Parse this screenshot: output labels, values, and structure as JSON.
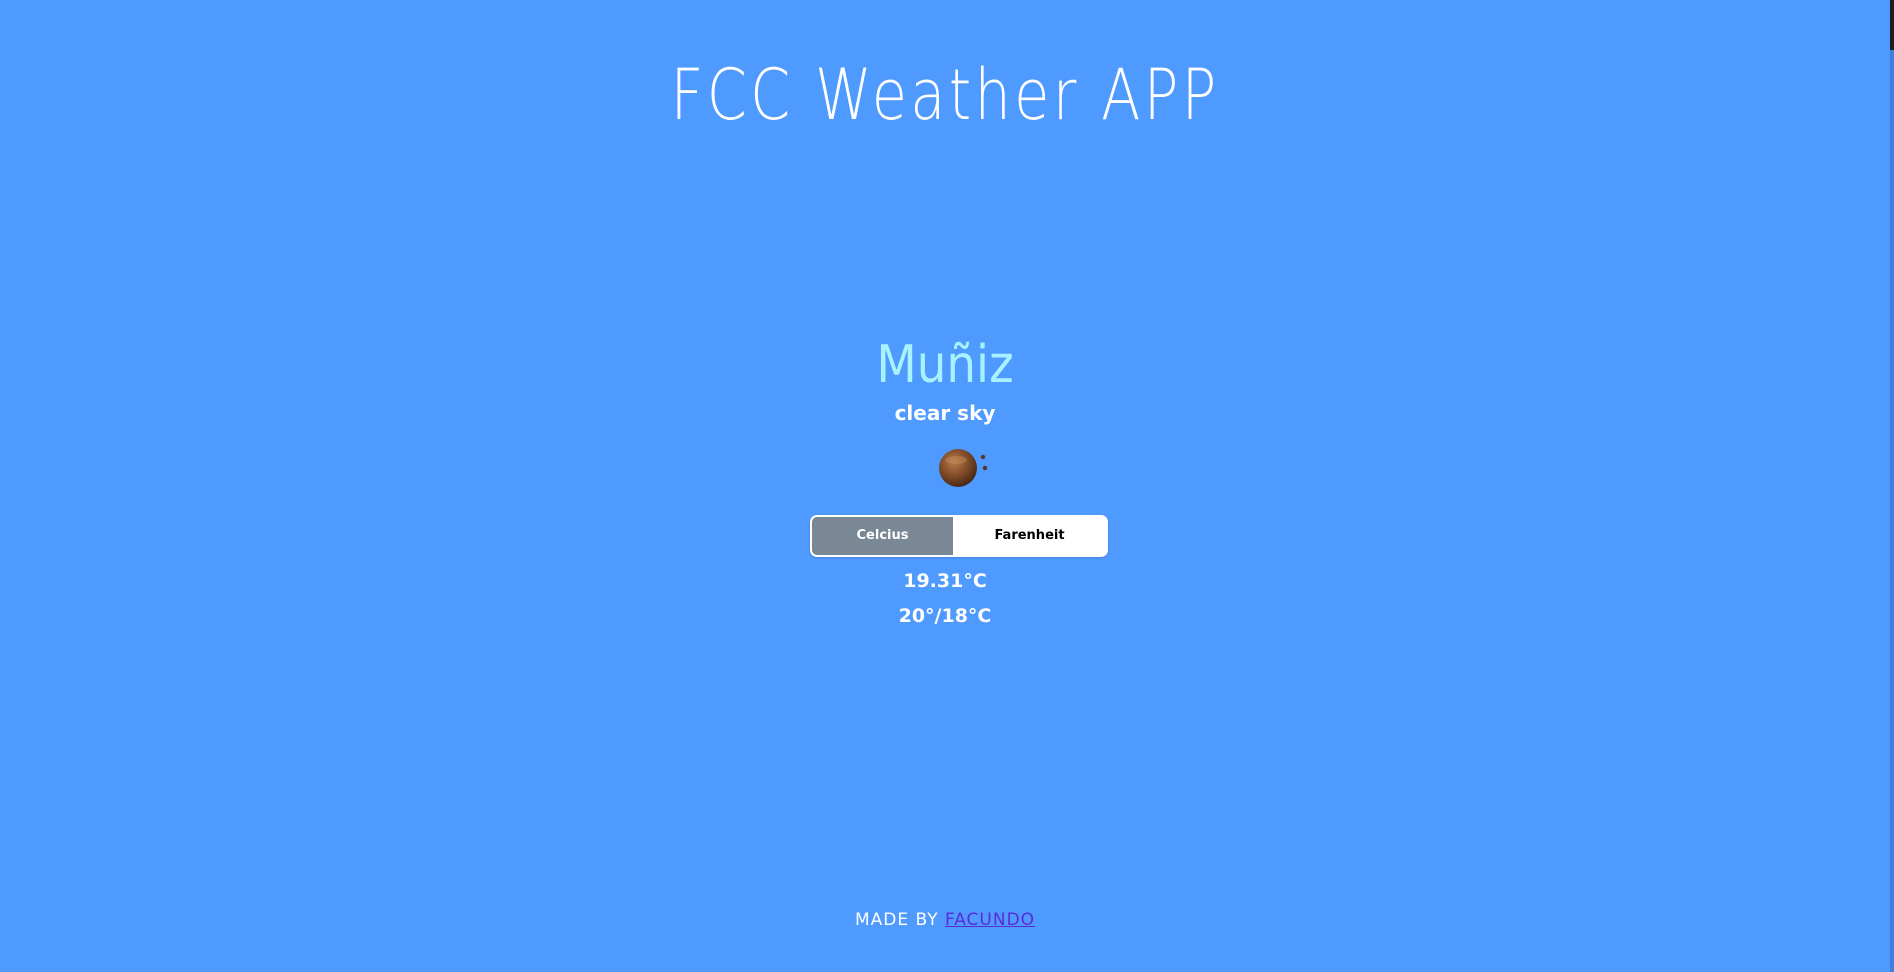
{
  "app": {
    "title": "FCC Weather APP"
  },
  "weather": {
    "city": "Muñiz",
    "description": "clear sky",
    "icon": "clear-night-moon-icon",
    "temperature": "19.31°C",
    "range": "20°/18°C"
  },
  "units": {
    "celcius_label": "Celcius",
    "farenheit_label": "Farenheit",
    "selected": "Celcius"
  },
  "footer": {
    "prefix": "MADE BY ",
    "author": "FACUNDO"
  },
  "colors": {
    "background": "#4f9aff",
    "city": "#a8f2ff",
    "selected_unit": "#7a8896",
    "link": "#5b2bd8"
  }
}
